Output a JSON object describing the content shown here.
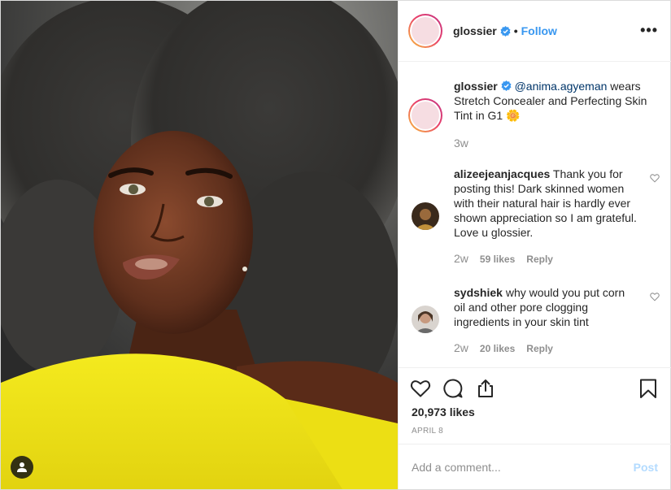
{
  "header": {
    "username": "glossier",
    "separator": "•",
    "follow_label": "Follow",
    "more_label": "•••"
  },
  "caption": {
    "username": "glossier",
    "mention": "@anima.agyeman",
    "text": " wears Stretch Concealer and Perfecting Skin Tint in G1 🌼",
    "time": "3w"
  },
  "comments": [
    {
      "username": "alizeejeanjacques",
      "text": " Thank you for posting this! Dark skinned women with their natural hair is hardly ever shown appreciation so I am grateful. Love u glossier.",
      "time": "2w",
      "likes": "59 likes",
      "reply_label": "Reply"
    },
    {
      "username": "sydshiek",
      "text": " why would you put corn oil and other pore clogging ingredients in your skin tint",
      "time": "2w",
      "likes": "20 likes",
      "reply_label": "Reply"
    }
  ],
  "footer": {
    "likes": "20,973 likes",
    "date": "APRIL 8",
    "comment_placeholder": "Add a comment...",
    "post_label": "Post"
  },
  "icons": {
    "heart": "heart-icon",
    "comment": "comment-icon",
    "share": "share-icon",
    "save": "bookmark-icon",
    "verified": "verified-badge-icon",
    "tag": "user-tag-icon"
  },
  "colors": {
    "link": "#3897f0",
    "mention": "#003569",
    "muted": "#8e8e8e",
    "post_disabled": "#b3dbff",
    "sweater": "#f2e516"
  }
}
